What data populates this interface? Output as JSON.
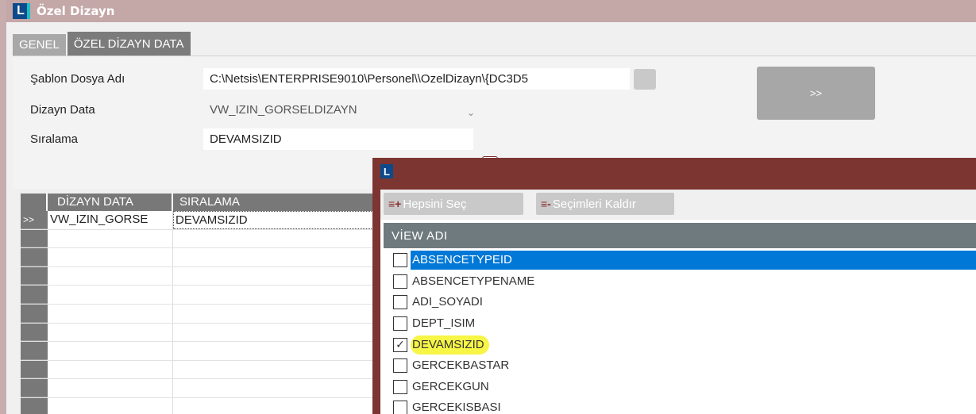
{
  "window": {
    "title": "Özel Dizayn",
    "logo_letter": "L"
  },
  "tabs": [
    {
      "label": "GENEL"
    },
    {
      "label": "ÖZEL DİZAYN DATA"
    }
  ],
  "form": {
    "sablon_label": "Şablon Dosya Adı",
    "sablon_value": "C:\\Netsis\\ENTERPRISE9010\\Personel\\\\OzelDizayn\\{DC3D5",
    "dizayn_label": "Dizayn Data",
    "dizayn_value": "VW_IZIN_GORSELDIZAYN",
    "siralama_label": "Sıralama",
    "siralama_value": "DEVAMSIZID",
    "go_label": ">>"
  },
  "grid": {
    "headers": [
      "DİZAYN DATA",
      "SIRALAMA"
    ],
    "rows": [
      {
        "indicator": ">>",
        "dizayn": "VW_IZIN_GORSE",
        "siralama": "DEVAMSIZID"
      },
      {
        "indicator": "",
        "dizayn": "",
        "siralama": ""
      },
      {
        "indicator": "",
        "dizayn": "",
        "siralama": ""
      },
      {
        "indicator": "",
        "dizayn": "",
        "siralama": ""
      },
      {
        "indicator": "",
        "dizayn": "",
        "siralama": ""
      },
      {
        "indicator": "",
        "dizayn": "",
        "siralama": ""
      },
      {
        "indicator": "",
        "dizayn": "",
        "siralama": ""
      },
      {
        "indicator": "",
        "dizayn": "",
        "siralama": ""
      },
      {
        "indicator": "",
        "dizayn": "",
        "siralama": ""
      },
      {
        "indicator": "",
        "dizayn": "",
        "siralama": ""
      },
      {
        "indicator": "",
        "dizayn": "",
        "siralama": ""
      }
    ]
  },
  "popup": {
    "logo_letter": "L",
    "select_all": "Hepsini Seç",
    "clear_selection": "Seçimleri Kaldır",
    "column_header": "VİEW ADI",
    "items": [
      {
        "label": "ABSENCETYPEID",
        "checked": false
      },
      {
        "label": "ABSENCETYPENAME",
        "checked": false
      },
      {
        "label": "ADI_SOYADI",
        "checked": false
      },
      {
        "label": "DEPT_ISIM",
        "checked": false
      },
      {
        "label": "DEVAMSIZID",
        "checked": true
      },
      {
        "label": "GERCEKBASTAR",
        "checked": false
      },
      {
        "label": "GERCEKGUN",
        "checked": false
      },
      {
        "label": "GERCEKISBASI",
        "checked": false
      }
    ]
  },
  "colors": {
    "title_bar": "#c4a7a7",
    "popup_frame": "#7c3531",
    "selection": "#0078d7",
    "highlight": "#f7f545"
  }
}
